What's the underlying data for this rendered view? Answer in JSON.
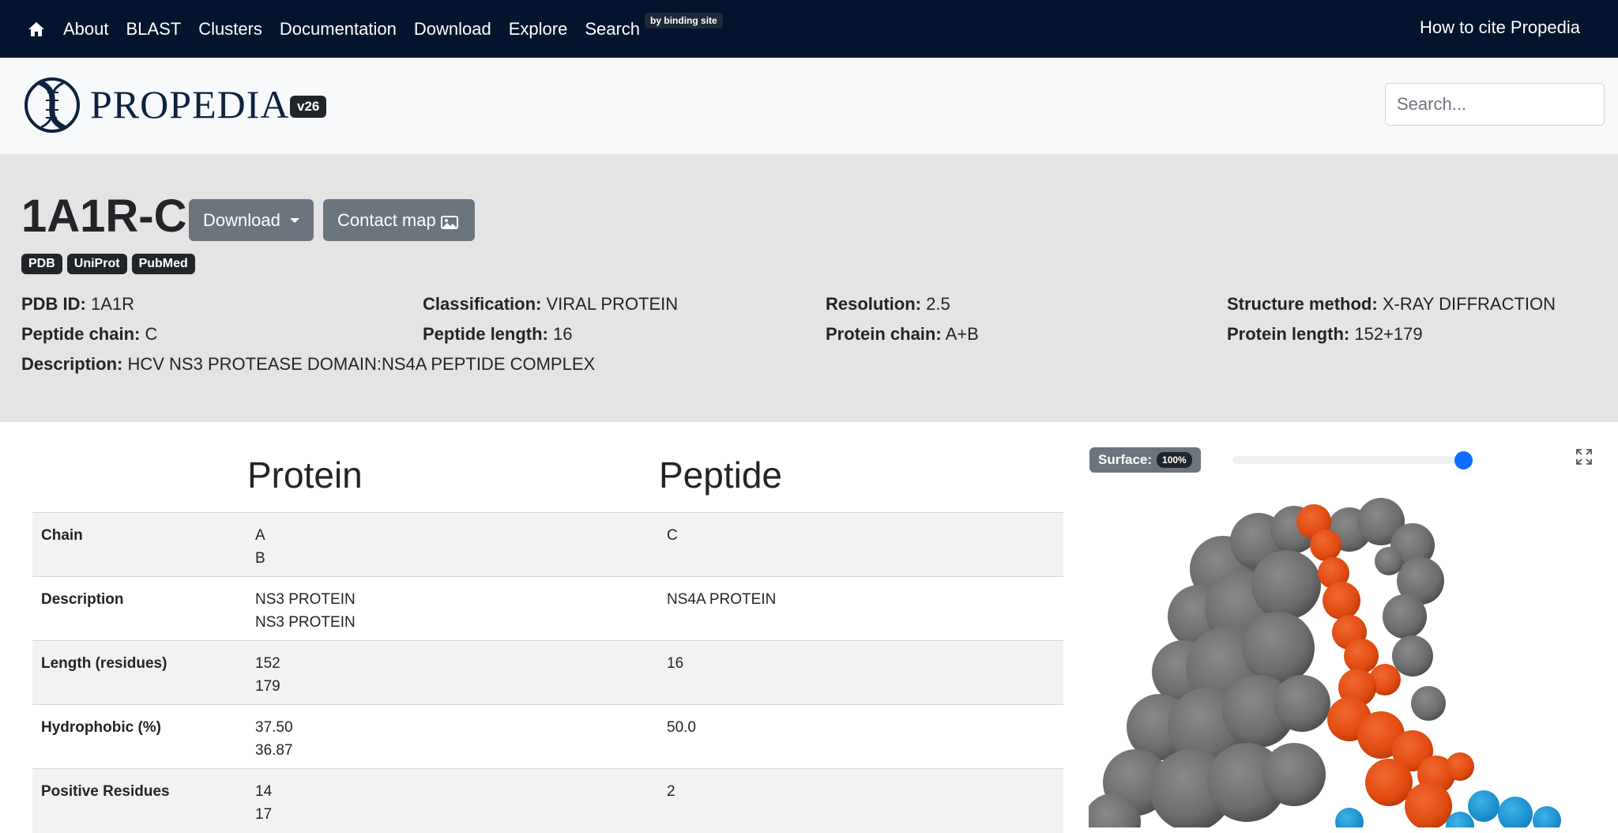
{
  "nav": {
    "items": [
      "About",
      "BLAST",
      "Clusters",
      "Documentation",
      "Download",
      "Explore",
      "Search"
    ],
    "search_badge": "by binding site",
    "cite": "How to cite Propedia"
  },
  "brand": {
    "name": "PROPEDIA",
    "version": "v26",
    "search_placeholder": "Search..."
  },
  "entry": {
    "id": "1A1R-C",
    "download_label": "Download",
    "contact_map_label": "Contact map",
    "links": [
      "PDB",
      "UniProt",
      "PubMed"
    ],
    "fields": {
      "pdb_id": {
        "label": "PDB ID:",
        "value": "1A1R"
      },
      "classification": {
        "label": "Classification:",
        "value": "VIRAL PROTEIN"
      },
      "resolution": {
        "label": "Resolution:",
        "value": "2.5"
      },
      "structure_method": {
        "label": "Structure method:",
        "value": "X-RAY DIFFRACTION"
      },
      "peptide_chain": {
        "label": "Peptide chain:",
        "value": "C"
      },
      "peptide_length": {
        "label": "Peptide length:",
        "value": "16"
      },
      "protein_chain": {
        "label": "Protein chain:",
        "value": "A+B"
      },
      "protein_length": {
        "label": "Protein length:",
        "value": "152+179"
      },
      "description": {
        "label": "Description:",
        "value": "HCV NS3 PROTEASE DOMAIN:NS4A PEPTIDE COMPLEX"
      }
    }
  },
  "table": {
    "headers": {
      "protein": "Protein",
      "peptide": "Peptide"
    },
    "rows": [
      {
        "label": "Chain",
        "protein": [
          "A",
          "B"
        ],
        "peptide": [
          "C"
        ]
      },
      {
        "label": "Description",
        "protein": [
          "NS3 PROTEIN",
          "NS3 PROTEIN"
        ],
        "peptide": [
          "NS4A PROTEIN"
        ]
      },
      {
        "label": "Length (residues)",
        "protein": [
          "152",
          "179"
        ],
        "peptide": [
          "16"
        ]
      },
      {
        "label": "Hydrophobic (%)",
        "protein": [
          "37.50",
          "36.87"
        ],
        "peptide": [
          "50.0"
        ]
      },
      {
        "label": "Positive Residues",
        "protein": [
          "14",
          "17"
        ],
        "peptide": [
          "2"
        ]
      }
    ]
  },
  "viewer": {
    "surface_label": "Surface:",
    "surface_value": "100%",
    "surface_opacity": 1.0,
    "colors": {
      "protein": "#6b6b6b",
      "peptide": "#e84a10",
      "other_chain": "#1a9ad6",
      "slider": "#0d6efd"
    }
  }
}
